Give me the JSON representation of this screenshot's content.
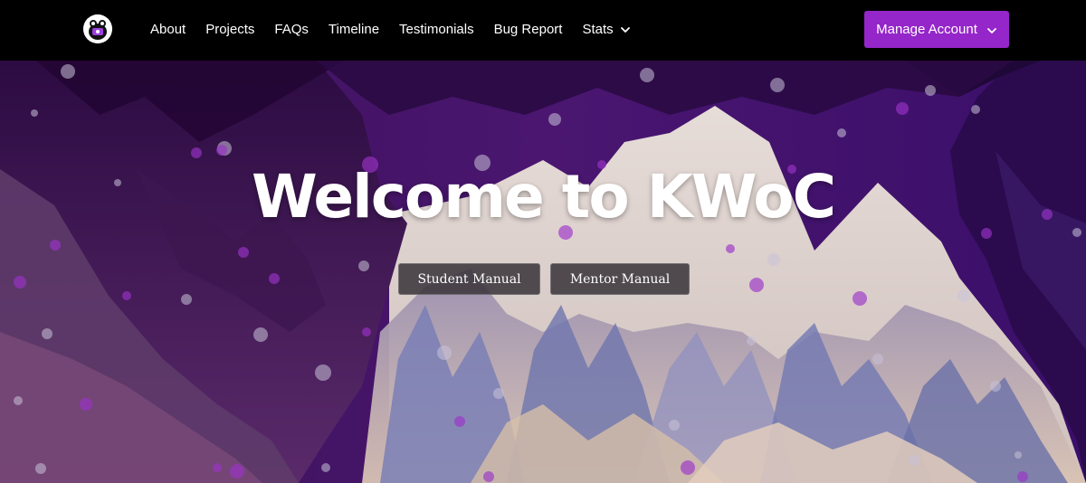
{
  "navbar": {
    "links": [
      {
        "label": "About"
      },
      {
        "label": "Projects"
      },
      {
        "label": "FAQs"
      },
      {
        "label": "Timeline"
      },
      {
        "label": "Testimonials"
      },
      {
        "label": "Bug Report"
      },
      {
        "label": "Stats"
      }
    ],
    "stats_has_dropdown": true,
    "manage_account_label": "Manage Account",
    "accent_color": "#9526c9"
  },
  "hero": {
    "title": "Welcome to KWoC",
    "buttons": {
      "student_manual": "Student Manual",
      "mentor_manual": "Mentor Manual"
    }
  },
  "icons": {
    "logo": "kwoc-logo-icon",
    "dropdown": "chevron-down-icon"
  }
}
